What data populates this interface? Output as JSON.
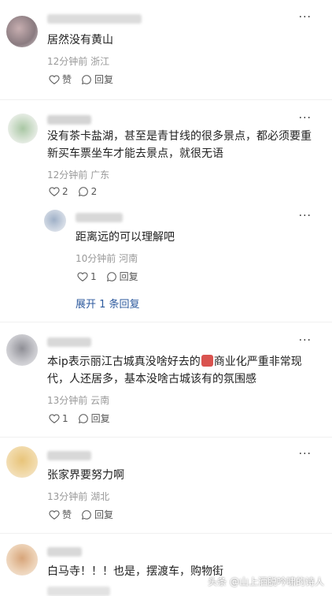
{
  "comments": [
    {
      "text": "居然没有黄山",
      "time": "12分钟前",
      "location": "浙江",
      "like_label": "赞",
      "reply_label": "回复"
    },
    {
      "text_line1": "没有茶卡盐湖，甚至是青甘线的很多景点，都必须要重",
      "text_line2": "新买车票坐车才能去景点，就很无语",
      "time": "12分钟前",
      "location": "广东",
      "like_count": "2",
      "reply_count": "2",
      "reply": {
        "text": "距离远的可以理解吧",
        "time": "10分钟前",
        "location": "河南",
        "like_count": "1",
        "reply_label": "回复"
      },
      "expand_label": "展开 1 条回复"
    },
    {
      "text_line1": "本ip表示丽江古城真没啥好去的",
      "text_line1b": "商业化严重非常现",
      "text_line2": "代，人还居多，基本没啥古城该有的氛围感",
      "time": "13分钟前",
      "location": "云南",
      "like_count": "1",
      "reply_label": "回复"
    },
    {
      "text": "张家界要努力啊",
      "time": "13分钟前",
      "location": "湖北",
      "like_label": "赞",
      "reply_label": "回复"
    },
    {
      "text": "白马寺！！！也是，摆渡车，购物街"
    }
  ],
  "more_glyph": "···",
  "watermark": "头条 @山上洒脱吟啸的诗人",
  "colors": {
    "link": "#2d5a9e",
    "meta": "#999999"
  },
  "icons": [
    "heart-icon",
    "comment-icon",
    "more-icon"
  ]
}
